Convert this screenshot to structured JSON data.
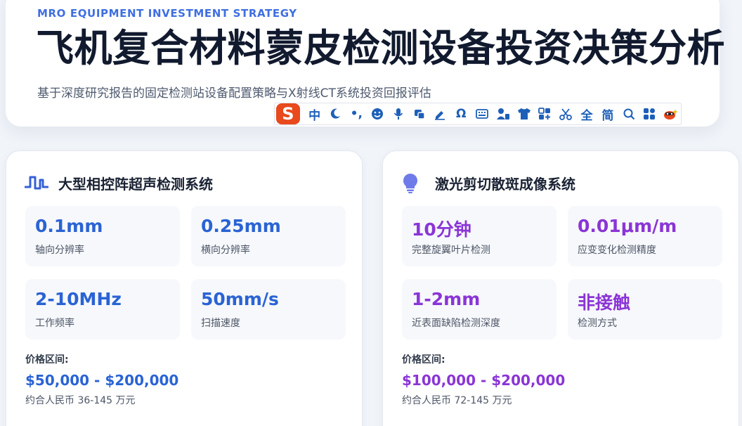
{
  "header": {
    "eyebrow": "MRO EQUIPMENT INVESTMENT STRATEGY",
    "title": "飞机复合材料蒙皮检测设备投资决策分析",
    "subtitle": "基于深度研究报告的固定检测站设备配置策略与X射线CT系统投资回报评估"
  },
  "ime_toolbar": {
    "logo": "S",
    "items": [
      {
        "name": "chinese-mode",
        "glyph": "中"
      },
      {
        "name": "half-width-moon-icon",
        "glyph": ""
      },
      {
        "name": "punctuation-icon",
        "glyph": "•,"
      },
      {
        "name": "emoji-icon",
        "glyph": ""
      },
      {
        "name": "microphone-icon",
        "glyph": ""
      },
      {
        "name": "screenshot-icon",
        "glyph": ""
      },
      {
        "name": "handwriting-icon",
        "glyph": ""
      },
      {
        "name": "special-symbol-icon",
        "glyph": "Ω"
      },
      {
        "name": "soft-keyboard-icon",
        "glyph": ""
      },
      {
        "name": "user-account-icon",
        "glyph": ""
      },
      {
        "name": "skin-shirt-icon",
        "glyph": ""
      },
      {
        "name": "toolbox-icon",
        "glyph": ""
      },
      {
        "name": "scissors-icon",
        "glyph": ""
      },
      {
        "name": "full-width-toggle",
        "glyph": "全"
      },
      {
        "name": "simplified-toggle",
        "glyph": "简"
      },
      {
        "name": "search-icon",
        "glyph": ""
      },
      {
        "name": "apps-grid-icon",
        "glyph": ""
      },
      {
        "name": "mascot-icon",
        "glyph": ""
      }
    ]
  },
  "cards": [
    {
      "title": "大型相控阵超声检测系统",
      "icon": "waveform-icon",
      "accent": "#2a63d4",
      "stats": [
        {
          "value": "0.1mm",
          "label": "轴向分辨率"
        },
        {
          "value": "0.25mm",
          "label": "横向分辨率"
        },
        {
          "value": "2-10MHz",
          "label": "工作频率"
        },
        {
          "value": "50mm/s",
          "label": "扫描速度"
        }
      ],
      "price_label": "价格区间:",
      "price_value": "$50,000 - $200,000",
      "price_rmb": "约合人民币 36-145 万元"
    },
    {
      "title": "激光剪切散斑成像系统",
      "icon": "lightbulb-icon",
      "accent": "#8a35d6",
      "stats": [
        {
          "value": "10分钟",
          "label": "完整旋翼叶片检测"
        },
        {
          "value": "0.01μm/m",
          "label": "应变变化检测精度"
        },
        {
          "value": "1-2mm",
          "label": "近表面缺陷检测深度"
        },
        {
          "value": "非接触",
          "label": "检测方式"
        }
      ],
      "price_label": "价格区间:",
      "price_value": "$100,000 - $200,000",
      "price_rmb": "约合人民币 72-145 万元"
    }
  ]
}
